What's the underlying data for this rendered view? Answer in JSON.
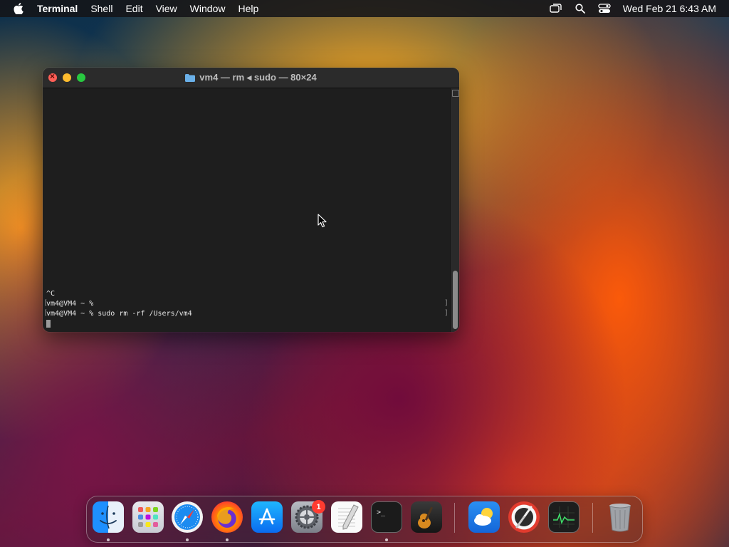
{
  "menubar": {
    "app_name": "Terminal",
    "menus": [
      "Shell",
      "Edit",
      "View",
      "Window",
      "Help"
    ],
    "clock": "Wed Feb 21  6:43 AM",
    "status_icons": [
      "screen-mirroring-icon",
      "spotlight-search-icon",
      "control-center-icon"
    ]
  },
  "terminal": {
    "title": "vm4 — rm ◂ sudo — 80×24",
    "lines": [
      "^C",
      "vm4@VM4 ~ %",
      "vm4@VM4 ~ % sudo rm -rf /Users/vm4"
    ],
    "bracket_open": "[",
    "bracket_close": "]"
  },
  "dock": {
    "apps": [
      {
        "name": "Finder",
        "icon": "finder-icon",
        "running": true
      },
      {
        "name": "Launchpad",
        "icon": "launchpad-icon",
        "running": false
      },
      {
        "name": "Safari",
        "icon": "safari-icon",
        "running": true
      },
      {
        "name": "Firefox",
        "icon": "firefox-icon",
        "running": true
      },
      {
        "name": "App Store",
        "icon": "app-store-icon",
        "running": false
      },
      {
        "name": "System Settings",
        "icon": "system-settings-icon",
        "running": false,
        "badge": "1"
      },
      {
        "name": "TextEdit",
        "icon": "textedit-icon",
        "running": false
      },
      {
        "name": "Terminal",
        "icon": "terminal-icon",
        "running": true
      },
      {
        "name": "GarageBand",
        "icon": "garageband-icon",
        "running": false
      },
      {
        "name": "Weather",
        "icon": "weather-icon",
        "running": false
      },
      {
        "name": "Instruments",
        "icon": "instruments-icon",
        "running": false
      },
      {
        "name": "Activity Monitor",
        "icon": "activity-monitor-icon",
        "running": false
      },
      {
        "name": "Trash",
        "icon": "trash-icon",
        "running": false
      }
    ]
  },
  "colors": {
    "close": "#ff5f57",
    "minimize": "#febc2e",
    "zoom": "#28c840",
    "badge": "#ff3b30"
  }
}
